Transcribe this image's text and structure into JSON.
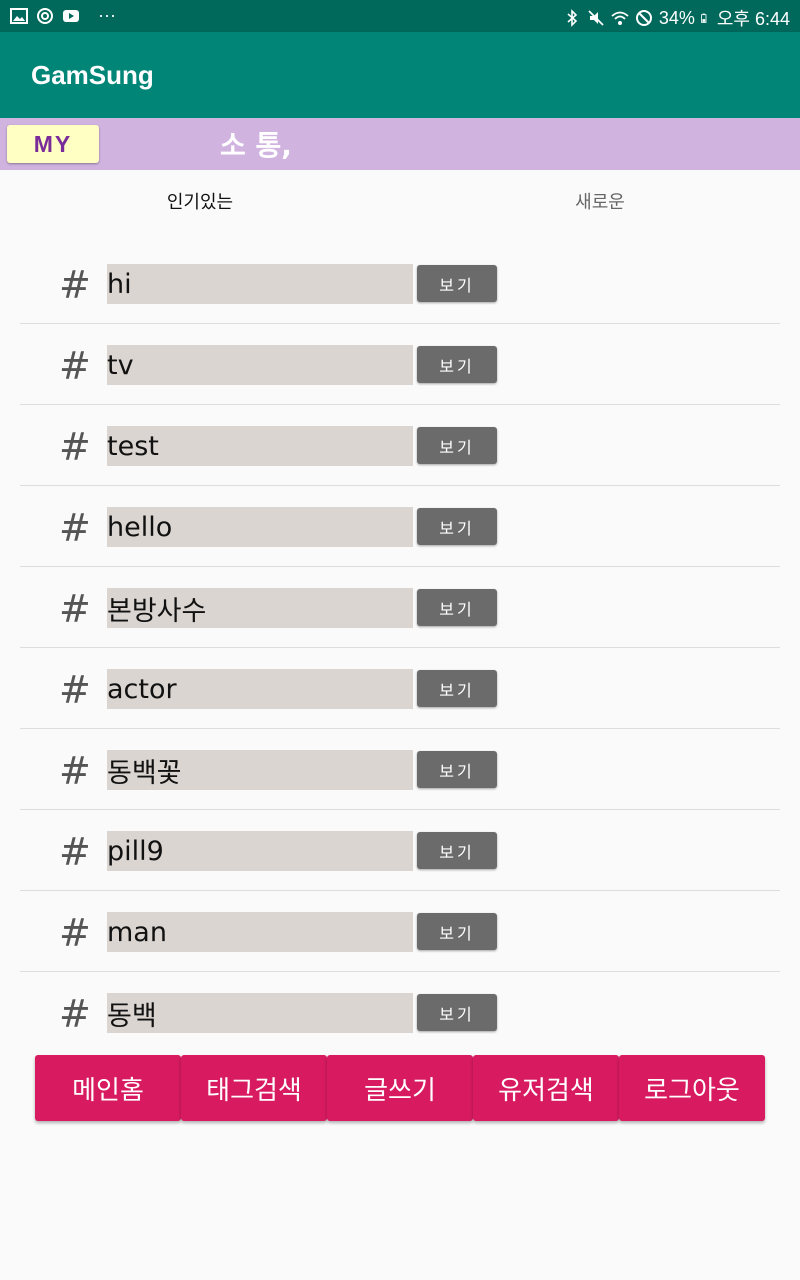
{
  "status_bar": {
    "left_icons": [
      "image-icon",
      "sync-icon",
      "youtube-icon",
      "more-dots-icon"
    ],
    "more": "···",
    "battery": "34%",
    "time": "오후 6:44",
    "right_icons": [
      "bluetooth-icon",
      "mute-icon",
      "wifi-icon",
      "no-entry-icon",
      "battery-icon"
    ]
  },
  "app_bar": {
    "title": "GamSung",
    "color": "#008577"
  },
  "header": {
    "my_label": "MY",
    "slogan": "소 통,",
    "color": "#d1b3e0"
  },
  "tabs": [
    {
      "label": "인기있는",
      "selected": true
    },
    {
      "label": "새로운",
      "selected": false
    }
  ],
  "tag_list": {
    "hash_symbol": "#",
    "items": [
      {
        "tag": "hi",
        "button": "보기"
      },
      {
        "tag": "tv",
        "button": "보기"
      },
      {
        "tag": "test",
        "button": "보기"
      },
      {
        "tag": "hello",
        "button": "보기"
      },
      {
        "tag": "본방사수",
        "button": "보기"
      },
      {
        "tag": "actor",
        "button": "보기"
      },
      {
        "tag": "동백꽃",
        "button": "보기"
      },
      {
        "tag": "pill9",
        "button": "보기"
      },
      {
        "tag": "man",
        "button": "보기"
      },
      {
        "tag": "동백",
        "button": "보기"
      }
    ]
  },
  "bottom_nav": {
    "color": "#d81b60",
    "items": [
      {
        "label": "메인홈"
      },
      {
        "label": "태그검색"
      },
      {
        "label": "글쓰기"
      },
      {
        "label": "유저검색"
      },
      {
        "label": "로그아웃"
      }
    ]
  }
}
